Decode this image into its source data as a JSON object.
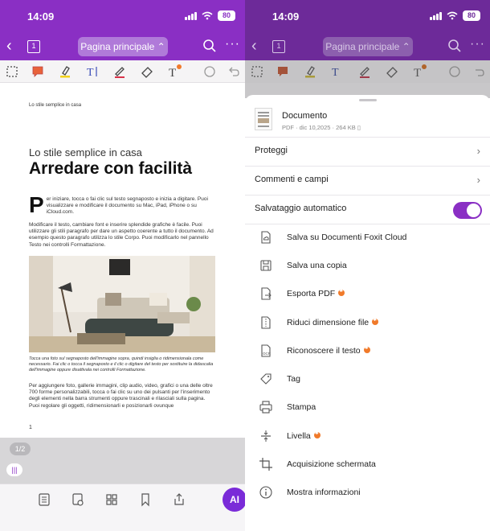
{
  "status_bar": {
    "time": "14:09",
    "battery": "80"
  },
  "nav": {
    "page_icon_number": "1",
    "page_selector": "Pagina principale"
  },
  "document": {
    "header_small": "Lo stile semplice in casa",
    "subtitle": "Lo stile semplice in casa",
    "title": "Arredare con facilità",
    "dropcap": "P",
    "para1": "er iniziare, tocca o fai clic sul testo segnaposto e inizia a digitare. Puoi visualizzare e modificare il documento su Mac, iPad, iPhone o su iCloud.com.",
    "para2": "Modificare il testo, cambiare font e inserire splendide grafiche è facile. Puoi utilizzare gli stili paragrafo per dare un aspetto coerente a tutto il documento. Ad esempio questo paragrafo utilizza lo stile Corpo. Puoi modificarlo nel pannello Testo nei controlli Formattazione.",
    "caption": "Tocca una foto sul segnaposto dell'immagine sopra, quindi insiglia o ridimensionala come necessario. Fai clic o tocca il segnaposto e il clic o digitare del testo per sostituire la didascalia dell'immagine oppure disattivala nei controlli Formattazione.",
    "para3": "Per aggiungere foto, gallerie immagini, clip audio, video, grafici o una delle oltre 700 forme personalizzabili, tocca o fai clic su uno dei pulsanti per l'inserimento degli elementi nella barra strumenti oppure trascinali e rilasciali sulla pagina. Puoi regolare gli oggetti, ridimensionarli e posizionarli ovunque",
    "page_number": "1"
  },
  "page_indicator": "1/2",
  "scroll_handle": "|||",
  "ai_button": "AI",
  "sheet": {
    "file_name": "Documento",
    "file_meta": "PDF · dic 10,2025 · 264 KB",
    "rows": [
      {
        "label": "Proteggi"
      },
      {
        "label": "Commenti e campi"
      }
    ],
    "autosave_label": "Salvataggio automatico",
    "autosave_on": true,
    "menu": [
      {
        "label": "Salva su Documenti Foxit Cloud",
        "icon": "cloud-document-icon",
        "premium": false
      },
      {
        "label": "Salva una copia",
        "icon": "save-copy-icon",
        "premium": false
      },
      {
        "label": "Esporta PDF",
        "icon": "export-pdf-icon",
        "premium": true
      },
      {
        "label": "Riduci dimensione file",
        "icon": "compress-file-icon",
        "premium": true
      },
      {
        "label": "Riconoscere il testo",
        "icon": "ocr-icon",
        "premium": true
      },
      {
        "label": "Tag",
        "icon": "tag-icon",
        "premium": false
      },
      {
        "label": "Stampa",
        "icon": "print-icon",
        "premium": false
      },
      {
        "label": "Livella",
        "icon": "flatten-icon",
        "premium": true
      },
      {
        "label": "Acquisizione schermata",
        "icon": "crop-icon",
        "premium": false
      },
      {
        "label": "Mostra informazioni",
        "icon": "info-icon",
        "premium": false
      }
    ]
  },
  "colors": {
    "accent": "#8a2fc4",
    "premium_badge": "#f07a2a"
  }
}
